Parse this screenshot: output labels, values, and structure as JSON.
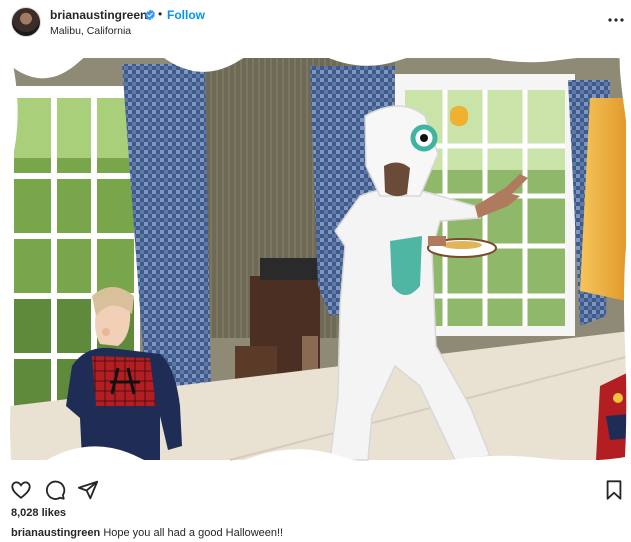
{
  "post": {
    "username": "brianaustingreen",
    "separator": "•",
    "follow_label": "Follow",
    "location": "Malibu, California",
    "likes": "8,028 likes",
    "caption_user": "brianaustingreen",
    "caption_text": "Hope you all had a good Halloween!!"
  },
  "icons": {
    "verified": "verified-badge-icon",
    "more": "more-options-icon",
    "like": "heart-icon",
    "comment": "comment-icon",
    "share": "paper-plane-icon",
    "save": "bookmark-icon"
  },
  "colors": {
    "link": "#0095f6",
    "text": "#262626",
    "verified": "#3897f0"
  }
}
